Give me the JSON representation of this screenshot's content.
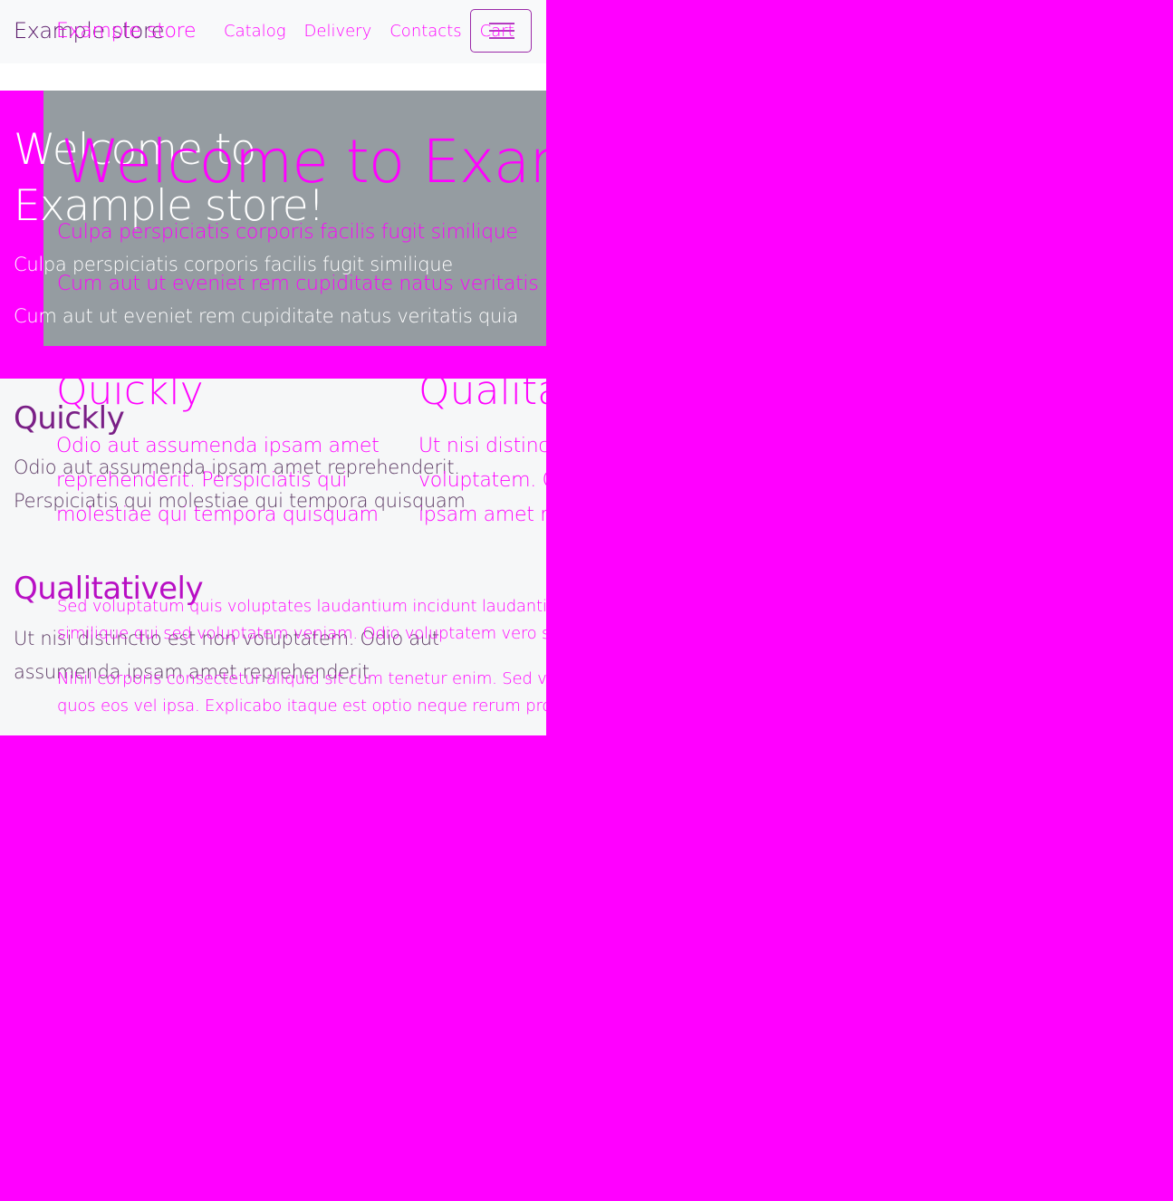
{
  "brand": "Example store",
  "nav": {
    "items": [
      "Catalog",
      "Delivery",
      "Contacts",
      "Cart"
    ]
  },
  "hero": {
    "title": "Welcome to Example store!",
    "title_desktop_visible": "Welcome to Exam",
    "line1": "Culpa perspiciatis corporis facilis fugit similique",
    "line2": "Cum aut ut eveniet rem cupiditate natus veritatis quia",
    "line2_desktop_visible": "Cum aut ut eveniet rem cupiditate natus veritatis qu"
  },
  "features": [
    {
      "title": "Quickly",
      "text": "Odio aut assumenda ipsam amet reprehenderit. Perspiciatis qui molestiae qui tempora quisquam"
    },
    {
      "title": "Qualitatively",
      "text": "Ut nisi distinctio est non voluptatem. Odio aut assumenda ipsam amet reprehenderit"
    }
  ],
  "desktop_columns": {
    "col1_lines": [
      "Odio aut assumenda ipsam amet",
      "reprehenderit. Perspiciatis qui",
      "molestiae qui tempora quisquam"
    ],
    "col2_title_visible": "Qualita",
    "col2_lines": [
      "Ut nisi distinct",
      "voluptatem. O",
      "ipsam amet re"
    ]
  },
  "lorem": [
    "Sed voluptatum quis voluptates laudantium incidunt laudanti",
    "similique qui sed voluptatem veniam. Odio voluptatem vero s",
    "Nihil corporis consectetur aliquid sit cum tenetur enim. Sed v",
    "quos eos vel ipsa. Explicabo itaque est optio neque rerum pro"
  ],
  "colors": {
    "background": "#ff00ff",
    "navbar": "#f8f9fa",
    "hero_gray": "#959ca1",
    "features_bg": "#f6f7f8",
    "brand_text": "#5a1a6a",
    "feature_title_1": "#7a1f86",
    "feature_title_2": "#b80fc4"
  },
  "icons": {
    "toggler": "hamburger-menu-icon"
  }
}
